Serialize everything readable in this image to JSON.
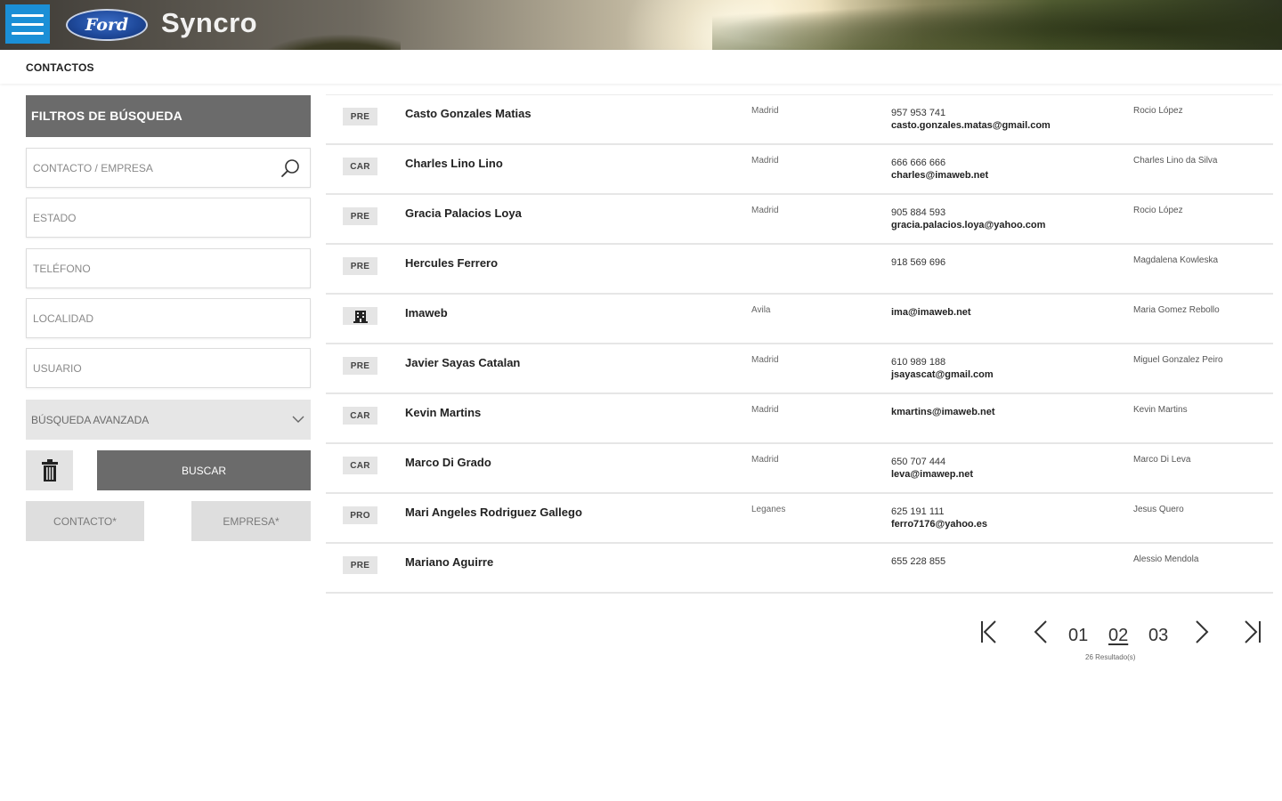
{
  "header": {
    "brand": "Syncro",
    "logo_text": "Ford"
  },
  "breadcrumb": {
    "title": "CONTACTOS"
  },
  "filters": {
    "title": "FILTROS DE BÚSQUEDA",
    "contact_placeholder": "CONTACTO / EMPRESA",
    "estado_placeholder": "ESTADO",
    "telefono_placeholder": "TELÉFONO",
    "localidad_placeholder": "LOCALIDAD",
    "usuario_placeholder": "USUARIO",
    "advanced_label": "BÚSQUEDA AVANZADA",
    "search_button": "BUSCAR",
    "contact_tag": "CONTACTO*",
    "company_tag": "EMPRESA*"
  },
  "contacts": [
    {
      "badge": "PRE",
      "name": "Casto Gonzales Matias",
      "city": "Madrid",
      "phone": "957 953 741",
      "email": "casto.gonzales.matas@gmail.com",
      "owner": "Rocio López"
    },
    {
      "badge": "CAR",
      "name": "Charles Lino Lino",
      "city": "Madrid",
      "phone": "666 666 666",
      "email": "charles@imaweb.net",
      "owner": "Charles Lino da Silva"
    },
    {
      "badge": "PRE",
      "name": "Gracia Palacios Loya",
      "city": "Madrid",
      "phone": "905 884 593",
      "email": "gracia.palacios.loya@yahoo.com",
      "owner": "Rocio López"
    },
    {
      "badge": "PRE",
      "name": "Hercules Ferrero",
      "city": "",
      "phone": "918 569 696",
      "email": "",
      "owner": "Magdalena Kowleska"
    },
    {
      "badge": "",
      "name": "Imaweb",
      "city": "Avila",
      "phone": "",
      "email": "ima@imaweb.net",
      "owner": "Maria Gomez Rebollo"
    },
    {
      "badge": "PRE",
      "name": "Javier Sayas Catalan",
      "city": "Madrid",
      "phone": "610 989 188",
      "email": "jsayascat@gmail.com",
      "owner": "Miguel Gonzalez Peiro"
    },
    {
      "badge": "CAR",
      "name": "Kevin Martins",
      "city": "Madrid",
      "phone": "",
      "email": "kmartins@imaweb.net",
      "owner": "Kevin Martins"
    },
    {
      "badge": "CAR",
      "name": "Marco Di Grado",
      "city": "Madrid",
      "phone": "650 707 444",
      "email": "leva@imawep.net",
      "owner": "Marco Di Leva"
    },
    {
      "badge": "PRO",
      "name": "Mari Angeles Rodriguez Gallego",
      "city": "Leganes",
      "phone": "625 191 111",
      "email": "ferro7176@yahoo.es",
      "owner": "Jesus Quero"
    },
    {
      "badge": "PRE",
      "name": "Mariano Aguirre",
      "city": "",
      "phone": "655 228 855",
      "email": "",
      "owner": "Alessio Mendola"
    }
  ],
  "pagination": {
    "pages": [
      "01",
      "02",
      "03"
    ],
    "current": "02",
    "results": "26 Resultado(s)"
  },
  "colors": {
    "menu_button": "#1b8fd6",
    "filter_header": "#6b6b6b",
    "search_button": "#6b6b6b",
    "badge_bg": "#e5e5e5"
  }
}
